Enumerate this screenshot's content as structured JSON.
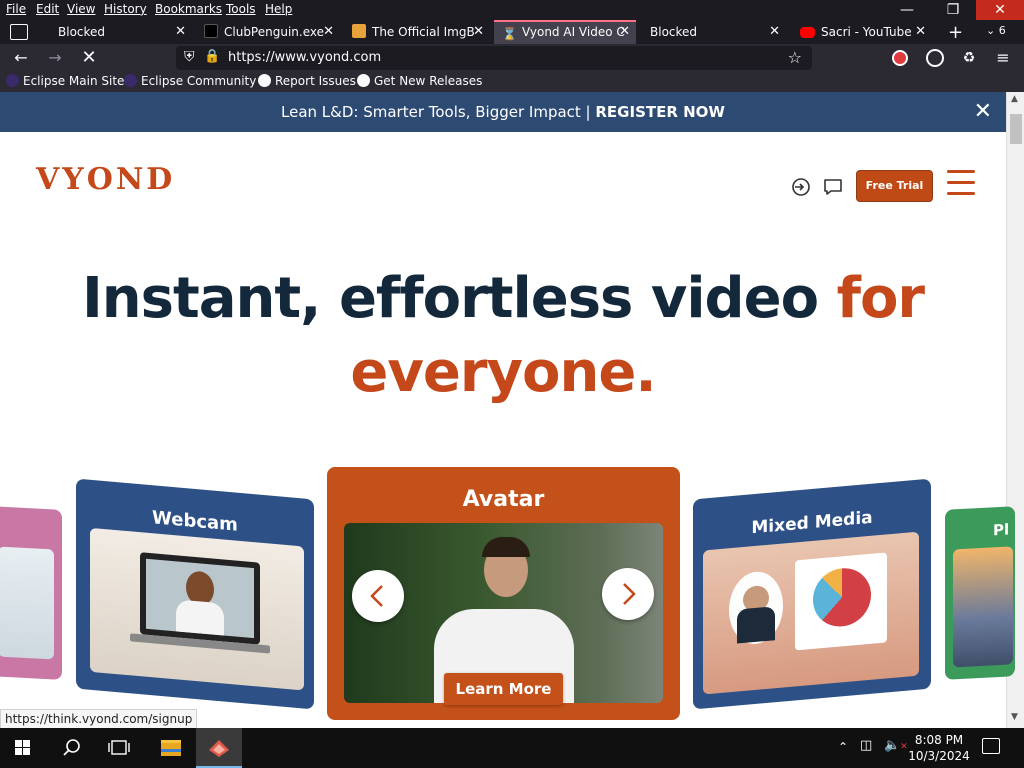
{
  "browser": {
    "menu": [
      "File",
      "Edit",
      "View",
      "History",
      "Bookmarks",
      "Tools",
      "Help"
    ],
    "tabs": [
      {
        "label": "Blocked",
        "active": false
      },
      {
        "label": "ClubPenguin.exe",
        "active": false
      },
      {
        "label": "The Official ImgB",
        "active": false
      },
      {
        "label": "Vyond AI Video C",
        "active": true
      },
      {
        "label": "Blocked",
        "active": false
      },
      {
        "label": "Sacri - YouTube",
        "active": false
      }
    ],
    "tab_count": "6",
    "url": "https://www.vyond.com",
    "bookmarks": [
      "Eclipse Main Site",
      "Eclipse Community",
      "Report Issues",
      "Get New Releases"
    ],
    "status_url": "https://think.vyond.com/signup"
  },
  "page": {
    "banner": {
      "text": "Lean L&D: Smarter Tools, Bigger Impact | ",
      "cta": "REGISTER NOW"
    },
    "logo": "VYOND",
    "header": {
      "free_trial": "Free Trial"
    },
    "headline": {
      "part1": "Instant, effortless video ",
      "accent1": "for",
      "accent2": "everyone."
    },
    "carousel": {
      "cards": [
        {
          "title": "Webcam"
        },
        {
          "title": "Avatar",
          "cta": "Learn More"
        },
        {
          "title": "Mixed Media"
        },
        {
          "title": "Pl"
        }
      ]
    }
  },
  "taskbar": {
    "time": "8:08 PM",
    "date": "10/3/2024"
  },
  "colors": {
    "brand_orange": "#c5481a",
    "navy": "#2d4a73",
    "headline": "#13283b"
  }
}
